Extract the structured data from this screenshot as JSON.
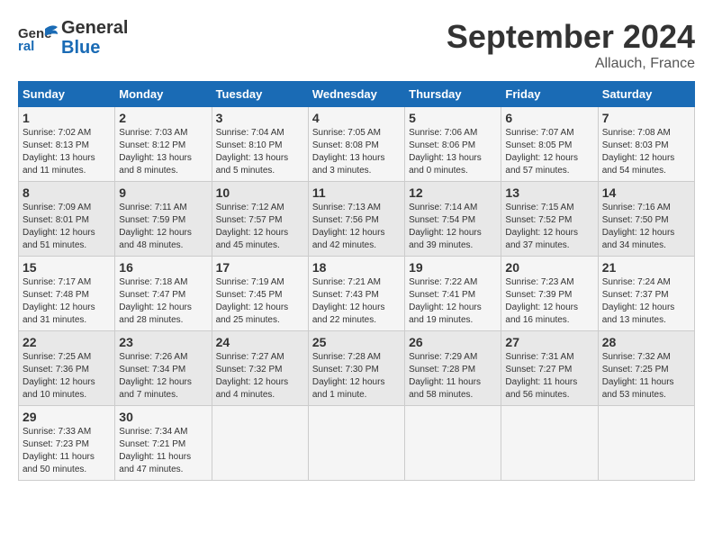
{
  "header": {
    "logo_line1": "General",
    "logo_line2": "Blue",
    "month": "September 2024",
    "location": "Allauch, France"
  },
  "days_of_week": [
    "Sunday",
    "Monday",
    "Tuesday",
    "Wednesday",
    "Thursday",
    "Friday",
    "Saturday"
  ],
  "weeks": [
    [
      {
        "num": "1",
        "sunrise": "7:02 AM",
        "sunset": "8:13 PM",
        "daylight": "13 hours and 11 minutes."
      },
      {
        "num": "2",
        "sunrise": "7:03 AM",
        "sunset": "8:12 PM",
        "daylight": "13 hours and 8 minutes."
      },
      {
        "num": "3",
        "sunrise": "7:04 AM",
        "sunset": "8:10 PM",
        "daylight": "13 hours and 5 minutes."
      },
      {
        "num": "4",
        "sunrise": "7:05 AM",
        "sunset": "8:08 PM",
        "daylight": "13 hours and 3 minutes."
      },
      {
        "num": "5",
        "sunrise": "7:06 AM",
        "sunset": "8:06 PM",
        "daylight": "13 hours and 0 minutes."
      },
      {
        "num": "6",
        "sunrise": "7:07 AM",
        "sunset": "8:05 PM",
        "daylight": "12 hours and 57 minutes."
      },
      {
        "num": "7",
        "sunrise": "7:08 AM",
        "sunset": "8:03 PM",
        "daylight": "12 hours and 54 minutes."
      }
    ],
    [
      {
        "num": "8",
        "sunrise": "7:09 AM",
        "sunset": "8:01 PM",
        "daylight": "12 hours and 51 minutes."
      },
      {
        "num": "9",
        "sunrise": "7:11 AM",
        "sunset": "7:59 PM",
        "daylight": "12 hours and 48 minutes."
      },
      {
        "num": "10",
        "sunrise": "7:12 AM",
        "sunset": "7:57 PM",
        "daylight": "12 hours and 45 minutes."
      },
      {
        "num": "11",
        "sunrise": "7:13 AM",
        "sunset": "7:56 PM",
        "daylight": "12 hours and 42 minutes."
      },
      {
        "num": "12",
        "sunrise": "7:14 AM",
        "sunset": "7:54 PM",
        "daylight": "12 hours and 39 minutes."
      },
      {
        "num": "13",
        "sunrise": "7:15 AM",
        "sunset": "7:52 PM",
        "daylight": "12 hours and 37 minutes."
      },
      {
        "num": "14",
        "sunrise": "7:16 AM",
        "sunset": "7:50 PM",
        "daylight": "12 hours and 34 minutes."
      }
    ],
    [
      {
        "num": "15",
        "sunrise": "7:17 AM",
        "sunset": "7:48 PM",
        "daylight": "12 hours and 31 minutes."
      },
      {
        "num": "16",
        "sunrise": "7:18 AM",
        "sunset": "7:47 PM",
        "daylight": "12 hours and 28 minutes."
      },
      {
        "num": "17",
        "sunrise": "7:19 AM",
        "sunset": "7:45 PM",
        "daylight": "12 hours and 25 minutes."
      },
      {
        "num": "18",
        "sunrise": "7:21 AM",
        "sunset": "7:43 PM",
        "daylight": "12 hours and 22 minutes."
      },
      {
        "num": "19",
        "sunrise": "7:22 AM",
        "sunset": "7:41 PM",
        "daylight": "12 hours and 19 minutes."
      },
      {
        "num": "20",
        "sunrise": "7:23 AM",
        "sunset": "7:39 PM",
        "daylight": "12 hours and 16 minutes."
      },
      {
        "num": "21",
        "sunrise": "7:24 AM",
        "sunset": "7:37 PM",
        "daylight": "12 hours and 13 minutes."
      }
    ],
    [
      {
        "num": "22",
        "sunrise": "7:25 AM",
        "sunset": "7:36 PM",
        "daylight": "12 hours and 10 minutes."
      },
      {
        "num": "23",
        "sunrise": "7:26 AM",
        "sunset": "7:34 PM",
        "daylight": "12 hours and 7 minutes."
      },
      {
        "num": "24",
        "sunrise": "7:27 AM",
        "sunset": "7:32 PM",
        "daylight": "12 hours and 4 minutes."
      },
      {
        "num": "25",
        "sunrise": "7:28 AM",
        "sunset": "7:30 PM",
        "daylight": "12 hours and 1 minute."
      },
      {
        "num": "26",
        "sunrise": "7:29 AM",
        "sunset": "7:28 PM",
        "daylight": "11 hours and 58 minutes."
      },
      {
        "num": "27",
        "sunrise": "7:31 AM",
        "sunset": "7:27 PM",
        "daylight": "11 hours and 56 minutes."
      },
      {
        "num": "28",
        "sunrise": "7:32 AM",
        "sunset": "7:25 PM",
        "daylight": "11 hours and 53 minutes."
      }
    ],
    [
      {
        "num": "29",
        "sunrise": "7:33 AM",
        "sunset": "7:23 PM",
        "daylight": "11 hours and 50 minutes."
      },
      {
        "num": "30",
        "sunrise": "7:34 AM",
        "sunset": "7:21 PM",
        "daylight": "11 hours and 47 minutes."
      },
      null,
      null,
      null,
      null,
      null
    ]
  ]
}
